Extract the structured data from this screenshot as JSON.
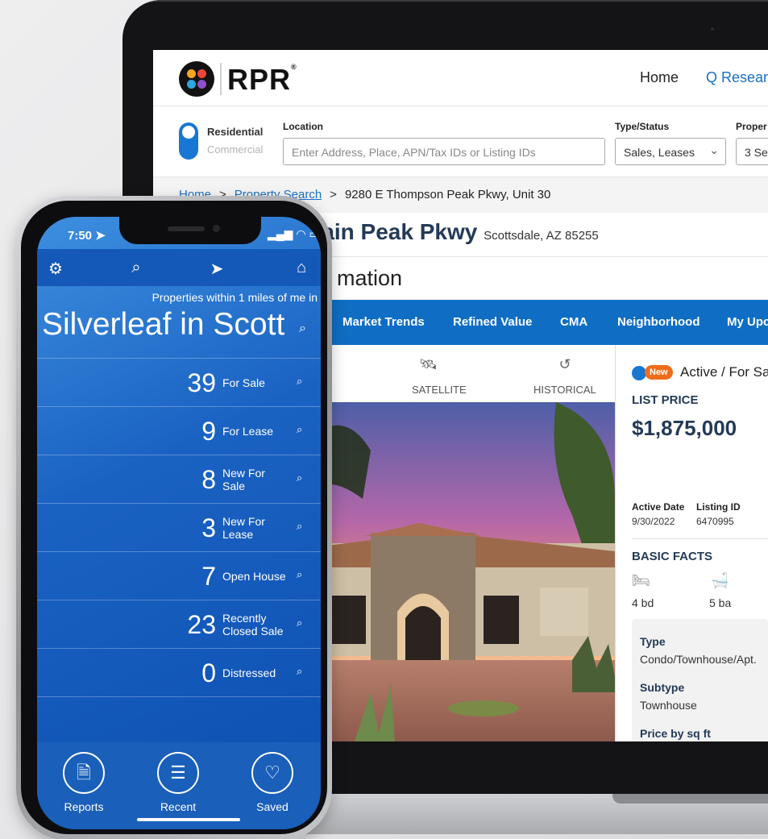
{
  "laptop": {
    "brand": "RPR",
    "nav": {
      "home": "Home",
      "research": "Q Resear"
    },
    "search": {
      "toggle_residential": "Residential",
      "toggle_commercial": "Commercial",
      "location_label": "Location",
      "location_placeholder": "Enter Address, Place, APN/Tax IDs or Listing IDs",
      "type_label": "Type/Status",
      "type_value": "Sales, Leases",
      "prop_label": "Proper",
      "prop_value": "3 Se"
    },
    "breadcrumb": [
      "Home",
      "Property Search",
      "9280 E Thompson Peak Pkwy, Unit 30"
    ],
    "address_title": "tain Peak Pkwy",
    "address_city": "Scottsdale, AZ 85255",
    "subtitle": "mation",
    "tabs": [
      "Market Trends",
      "Refined Value",
      "CMA",
      "Neighborhood",
      "My Upc"
    ],
    "map_options": [
      "ET",
      "SATELLITE",
      "HISTORICAL"
    ],
    "listing": {
      "badge": "New",
      "status": "Active / For Sa",
      "list_price_label": "LIST PRICE",
      "price": "$1,875,000",
      "active_date_label": "Active Date",
      "active_date": "9/30/2022",
      "listing_id_label": "Listing ID",
      "listing_id": "6470995",
      "basic_facts": "BASIC FACTS",
      "beds": "4 bd",
      "baths": "5 ba",
      "type_label": "Type",
      "type": "Condo/Townhouse/Apt.",
      "subtype_label": "Subtype",
      "subtype": "Townhouse",
      "price_sqft_label": "Price by sq ft"
    }
  },
  "phone": {
    "time": "7:50",
    "within": "Properties within 1 miles of me in",
    "neighborhood": "Silverleaf in Scott",
    "rows": [
      {
        "count": "39",
        "label": "For Sale"
      },
      {
        "count": "9",
        "label": "For Lease"
      },
      {
        "count": "8",
        "label": "New For Sale"
      },
      {
        "count": "3",
        "label": "New For Lease"
      },
      {
        "count": "7",
        "label": "Open House"
      },
      {
        "count": "23",
        "label": "Recently Closed Sale"
      },
      {
        "count": "0",
        "label": "Distressed"
      }
    ],
    "bottom": {
      "reports": "Reports",
      "recent": "Recent",
      "saved": "Saved"
    }
  }
}
